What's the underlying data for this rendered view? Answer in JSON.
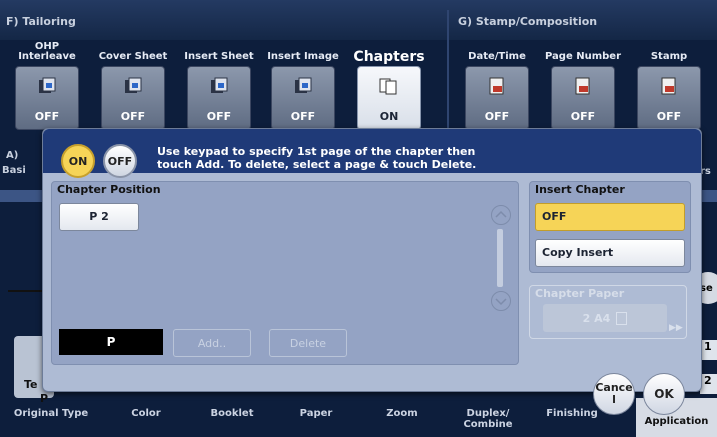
{
  "sections": {
    "tailoring_header": "F)  Tailoring",
    "stamp_header": "G)  Stamp/Composition"
  },
  "functions": [
    {
      "label": "OHP\nInterleave",
      "status": "OFF",
      "icon": "interleave-icon"
    },
    {
      "label": "Cover Sheet",
      "status": "OFF",
      "icon": "cover-sheet-icon"
    },
    {
      "label": "Insert Sheet",
      "status": "OFF",
      "icon": "insert-sheet-icon"
    },
    {
      "label": "Insert Image",
      "status": "OFF",
      "icon": "insert-image-icon"
    },
    {
      "label": "Chapters",
      "status": "ON",
      "icon": "chapters-icon"
    },
    {
      "label": "Date/Time",
      "status": "OFF",
      "icon": "date-time-icon"
    },
    {
      "label": "Page Number",
      "status": "OFF",
      "icon": "page-number-icon"
    },
    {
      "label": "Stamp",
      "status": "OFF",
      "icon": "stamp-icon"
    }
  ],
  "background_partial": {
    "a_label": "A)",
    "basic_label": "Basi",
    "rs_label": "rs",
    "te_label": "Te",
    "pr_label": "P",
    "se_label": "se",
    "num1": "1",
    "num2": "2"
  },
  "dialog": {
    "on_label": "ON",
    "off_label": "OFF",
    "instruction": "Use keypad to specify 1st page of the chapter then\ntouch Add.  To delete, select a page & touch Delete.",
    "chapter_position_label": "Chapter Position",
    "entries": [
      "P 2"
    ],
    "input_value": "P",
    "add_label": "Add..",
    "delete_label": "Delete",
    "insert_chapter_label": "Insert Chapter",
    "insert_options": [
      "OFF",
      "Copy Insert"
    ],
    "insert_selected": "OFF",
    "chapter_paper_label": "Chapter Paper",
    "chapter_paper_value": "2  A4",
    "cancel_label": "Cance\nl",
    "ok_label": "OK"
  },
  "bottom_tabs": [
    "Original Type",
    "Color",
    "Booklet",
    "Paper",
    "Zoom",
    "Duplex/\nCombine",
    "Finishing",
    "Application"
  ],
  "colors": {
    "background": "#0d1e3c",
    "selected_on": "#f3d35a",
    "panel": "#94a3c4"
  }
}
